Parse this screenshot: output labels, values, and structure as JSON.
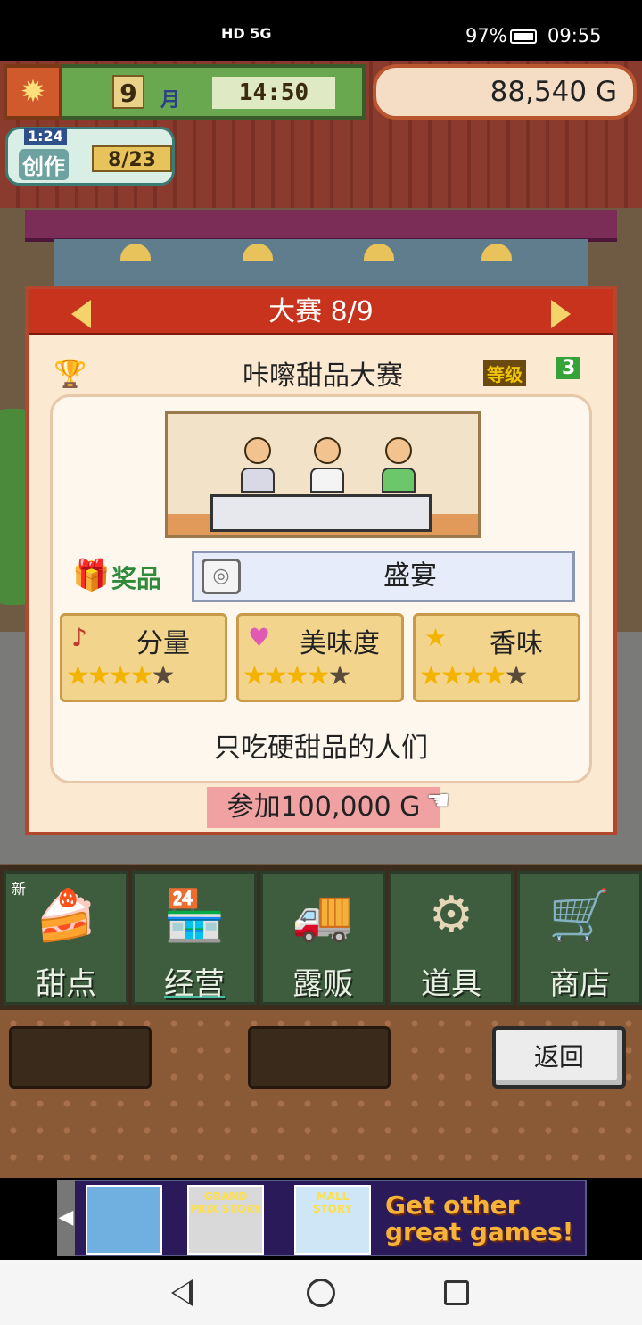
{
  "status_bar": {
    "network": "HD 5G",
    "battery": "97%",
    "time": "09:55"
  },
  "hud": {
    "month_number": "9",
    "month_unit": "月",
    "clock": "14:50",
    "money": "88,540 G",
    "create_timer": "1:24",
    "create_label": "创作",
    "create_count": "8/23"
  },
  "contest": {
    "header": "大赛 8/9",
    "name": "咔嚓甜品大赛",
    "rank_badge": "等级",
    "rank": "3",
    "prize_label": "奖品",
    "prize_value": "盛宴",
    "attributes": [
      {
        "label": "分量",
        "icon": "music-note-icon",
        "stars_on": 4,
        "stars_total": 5
      },
      {
        "label": "美味度",
        "icon": "heart-icon",
        "stars_on": 4,
        "stars_total": 5
      },
      {
        "label": "香味",
        "icon": "star-icon",
        "stars_on": 4,
        "stars_total": 5
      }
    ],
    "description": "只吃硬甜品的人们",
    "join_button": "参加100,000 G"
  },
  "tabs": [
    {
      "label": "甜点",
      "icon": "cake-icon",
      "badge": "新",
      "active": false
    },
    {
      "label": "经营",
      "icon": "shop-icon",
      "badge": "",
      "active": true
    },
    {
      "label": "露贩",
      "icon": "food-truck-icon",
      "badge": "",
      "active": false
    },
    {
      "label": "道具",
      "icon": "items-icon",
      "badge": "",
      "active": false
    },
    {
      "label": "商店",
      "icon": "cart-icon",
      "badge": "",
      "active": false
    }
  ],
  "back_button": "返回",
  "ad": {
    "games": [
      "GRAND PRIX STORY",
      "MALL STORY"
    ],
    "cta_line1": "Get other",
    "cta_line2": "great games!"
  }
}
